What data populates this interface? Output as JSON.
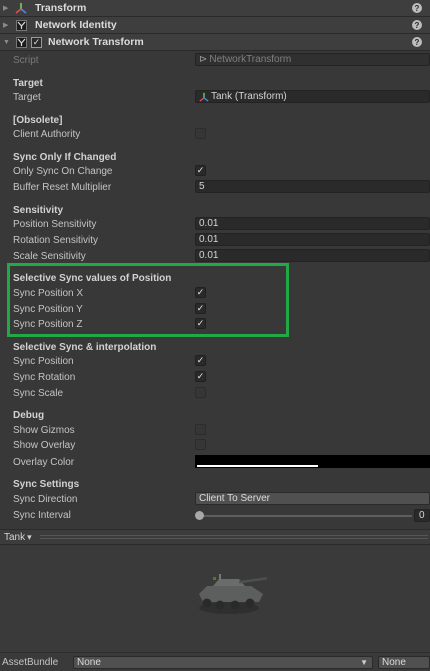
{
  "components": {
    "transform": {
      "title": "Transform"
    },
    "network_identity": {
      "title": "Network Identity"
    },
    "network_transform": {
      "title": "Network Transform",
      "enabled": true
    }
  },
  "help_glyph": "?",
  "script": {
    "label": "Script",
    "value": "NetworkTransform"
  },
  "target_section": {
    "header": "Target",
    "label": "Target",
    "value": "Tank (Transform)"
  },
  "obsolete_section": {
    "header": "[Obsolete]",
    "client_authority_label": "Client Authority",
    "client_authority": false
  },
  "sync_only_changed": {
    "header": "Sync Only If Changed",
    "only_sync_label": "Only Sync On Change",
    "only_sync": true,
    "buffer_label": "Buffer Reset Multiplier",
    "buffer_value": "5"
  },
  "sensitivity": {
    "header": "Sensitivity",
    "position_label": "Position Sensitivity",
    "position_value": "0.01",
    "rotation_label": "Rotation Sensitivity",
    "rotation_value": "0.01",
    "scale_label": "Scale Sensitivity",
    "scale_value": "0.01"
  },
  "selective_position": {
    "header": "Selective Sync values of Position",
    "x_label": "Sync Position X",
    "x": true,
    "y_label": "Sync Position Y",
    "y": true,
    "z_label": "Sync Position Z",
    "z": true
  },
  "selective_interp": {
    "header": "Selective Sync & interpolation",
    "position_label": "Sync Position",
    "position": true,
    "rotation_label": "Sync Rotation",
    "rotation": true,
    "scale_label": "Sync Scale",
    "scale": false
  },
  "debug": {
    "header": "Debug",
    "gizmos_label": "Show Gizmos",
    "gizmos": false,
    "overlay_label": "Show Overlay",
    "overlay": false,
    "overlay_color_label": "Overlay Color"
  },
  "sync_settings": {
    "header": "Sync Settings",
    "direction_label": "Sync Direction",
    "direction_value": "Client To Server",
    "interval_label": "Sync Interval",
    "interval_value": "0"
  },
  "preview": {
    "name": "Tank",
    "dropdown_glyph": "▾"
  },
  "asset_bundle": {
    "label": "AssetBundle",
    "bundle_value": "None",
    "variant_value": "None"
  },
  "check_glyph": "✓",
  "colors": {
    "highlight": "#22a845",
    "background": "#383838",
    "field": "#2a2a2a"
  }
}
